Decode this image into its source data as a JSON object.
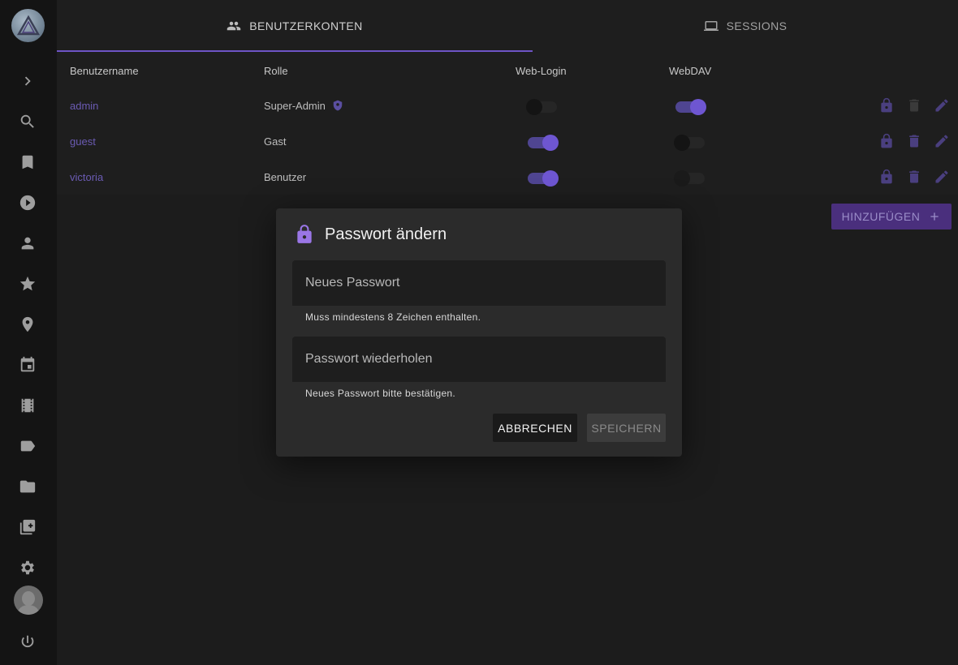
{
  "tabs": [
    {
      "label": "BENUTZERKONTEN",
      "icon": "people-icon",
      "active": true
    },
    {
      "label": "SESSIONS",
      "icon": "laptop-icon",
      "active": false
    }
  ],
  "table": {
    "headers": [
      "Benutzername",
      "Rolle",
      "Web-Login",
      "WebDAV"
    ],
    "rows": [
      {
        "username": "admin",
        "role": "Super-Admin",
        "role_badge": "shield-icon",
        "web_login": false,
        "webdav": true
      },
      {
        "username": "guest",
        "role": "Gast",
        "web_login": true,
        "webdav": false
      },
      {
        "username": "victoria",
        "role": "Benutzer",
        "web_login": true,
        "webdav": false
      }
    ]
  },
  "add_button": {
    "label": "HINZUFÜGEN"
  },
  "dialog": {
    "title": "Passwort ändern",
    "new_password": {
      "placeholder": "Neues Passwort",
      "value": "",
      "hint": "Muss mindestens 8 Zeichen enthalten."
    },
    "repeat_password": {
      "placeholder": "Passwort wiederholen",
      "value": "",
      "hint": "Neues Passwort bitte bestätigen."
    },
    "cancel_label": "ABBRECHEN",
    "save_label": "SPEICHERN"
  },
  "colors": {
    "accent": "#6e56d1",
    "lock": "#9a76e6",
    "link": "#6b5bb3"
  }
}
